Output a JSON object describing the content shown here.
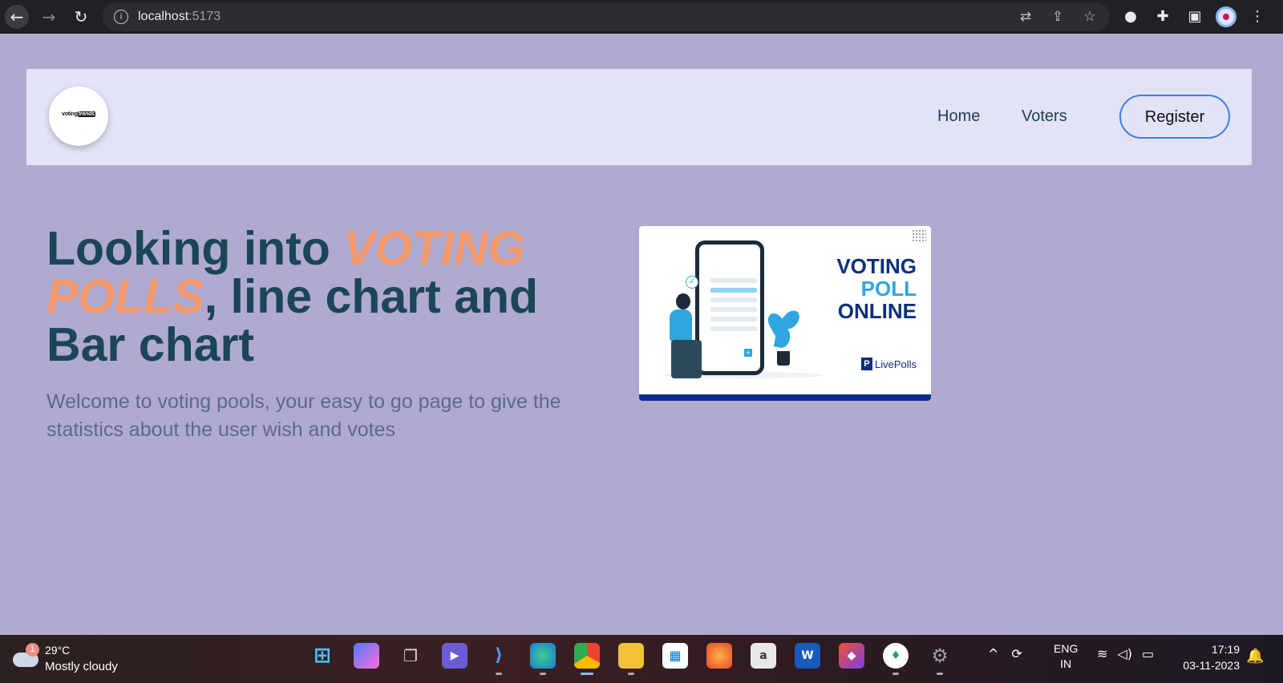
{
  "browser": {
    "url_host": "localhost",
    "url_port": ":5173"
  },
  "navbar": {
    "logo_text_a": "voting",
    "logo_text_b": "trends",
    "links": [
      {
        "label": "Home"
      },
      {
        "label": "Voters"
      }
    ],
    "register_label": "Register"
  },
  "hero": {
    "title_part1": "Looking into ",
    "title_accent": "VOTING POLLS",
    "title_part2": ", line chart and Bar chart",
    "subtitle": "Welcome to voting pools, your easy to go page to give the statistics about the user wish and votes"
  },
  "poll_image": {
    "line1": "VOTING",
    "line2": "POLL",
    "line3": "ONLINE",
    "brand": "LivePolls",
    "accent_color": "#2fa6e0",
    "navy_color": "#0d2f7e"
  },
  "taskbar": {
    "weather_badge": "1",
    "temperature": "29°C",
    "condition": "Mostly cloudy",
    "lang_1": "ENG",
    "lang_2": "IN",
    "time": "17:19",
    "date": "03-11-2023"
  },
  "colors": {
    "page_bg": "#b0aad0",
    "navbar_bg": "#e3e3f8",
    "title_color": "#1b4655",
    "accent": "#f59a6c",
    "register_border": "#3d7fe0"
  }
}
